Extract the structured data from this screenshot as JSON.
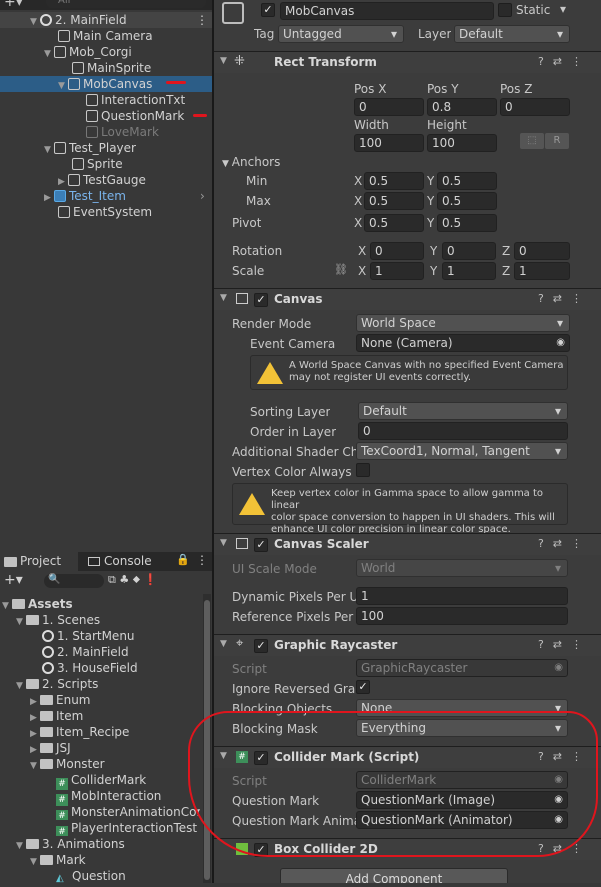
{
  "hierarchy": {
    "search_placeholder": "All",
    "items": [
      {
        "label": "2. MainField"
      },
      {
        "label": "Main Camera"
      },
      {
        "label": "Mob_Corgi"
      },
      {
        "label": "MainSprite"
      },
      {
        "label": "MobCanvas"
      },
      {
        "label": "InteractionTxt"
      },
      {
        "label": "QuestionMark"
      },
      {
        "label": "LoveMark"
      },
      {
        "label": "Test_Player"
      },
      {
        "label": "Sprite"
      },
      {
        "label": "TestGauge"
      },
      {
        "label": "Test_Item"
      },
      {
        "label": "EventSystem"
      }
    ]
  },
  "project": {
    "tab_project": "Project",
    "tab_console": "Console",
    "items": [
      {
        "label": "Assets"
      },
      {
        "label": "1. Scenes"
      },
      {
        "label": "1. StartMenu"
      },
      {
        "label": "2. MainField"
      },
      {
        "label": "3. HouseField"
      },
      {
        "label": "2. Scripts"
      },
      {
        "label": "Enum"
      },
      {
        "label": "Item"
      },
      {
        "label": "Item_Recipe"
      },
      {
        "label": "JSJ"
      },
      {
        "label": "Monster"
      },
      {
        "label": "ColliderMark"
      },
      {
        "label": "MobInteraction"
      },
      {
        "label": "MonsterAnimationCon"
      },
      {
        "label": "PlayerInteractionTest"
      },
      {
        "label": "3. Animations"
      },
      {
        "label": "Mark"
      },
      {
        "label": "Question"
      }
    ]
  },
  "inspector": {
    "object_name": "MobCanvas",
    "static_label": "Static",
    "tag_label": "Tag",
    "tag_value": "Untagged",
    "layer_label": "Layer",
    "layer_value": "Default",
    "rect": {
      "title": "Rect Transform",
      "posx_label": "Pos X",
      "posy_label": "Pos Y",
      "posz_label": "Pos Z",
      "posx": "0",
      "posy": "0.8",
      "posz": "0",
      "width_label": "Width",
      "height_label": "Height",
      "width": "100",
      "height": "100",
      "r_button": "R",
      "anchors_label": "Anchors",
      "min_label": "Min",
      "max_label": "Max",
      "pivot_label": "Pivot",
      "min_x": "0.5",
      "min_y": "0.5",
      "max_x": "0.5",
      "max_y": "0.5",
      "pivot_x": "0.5",
      "pivot_y": "0.5",
      "rotation_label": "Rotation",
      "scale_label": "Scale",
      "rot_x": "0",
      "rot_y": "0",
      "rot_z": "0",
      "scale_x": "1",
      "scale_y": "1",
      "scale_z": "1",
      "x": "X",
      "y": "Y",
      "z": "Z"
    },
    "canvas": {
      "title": "Canvas",
      "render_mode_label": "Render Mode",
      "render_mode": "World Space",
      "event_camera_label": "Event Camera",
      "event_camera": "None (Camera)",
      "warn1_line1": "A World Space Canvas with no specified Event Camera",
      "warn1_line2": "may not register UI events correctly.",
      "sorting_layer_label": "Sorting Layer",
      "sorting_layer": "Default",
      "order_label": "Order in Layer",
      "order": "0",
      "shader_label": "Additional Shader Cha",
      "shader": "TexCoord1, Normal, Tangent",
      "vertex_label": "Vertex Color Always In",
      "warn2_line1": "Keep vertex color in Gamma space to allow gamma to linear",
      "warn2_line2": "color space conversion to happen in UI shaders. This will",
      "warn2_line3": "enhance UI color precision in linear color space."
    },
    "scaler": {
      "title": "Canvas Scaler",
      "ui_scale_label": "UI Scale Mode",
      "ui_scale": "World",
      "dyn_label": "Dynamic Pixels Per U",
      "dyn": "1",
      "ref_label": "Reference Pixels Per U",
      "ref": "100"
    },
    "raycaster": {
      "title": "Graphic Raycaster",
      "script_label": "Script",
      "script": "GraphicRaycaster",
      "ignore_label": "Ignore Reversed Grap",
      "blocking_objects_label": "Blocking Objects",
      "blocking_objects": "None",
      "blocking_mask_label": "Blocking Mask",
      "blocking_mask": "Everything"
    },
    "collider_mark": {
      "title": "Collider Mark (Script)",
      "script_label": "Script",
      "script": "ColliderMark",
      "qm_label": "Question Mark",
      "qm": "QuestionMark (Image)",
      "qma_label": "Question Mark Anima",
      "qma": "QuestionMark (Animator)"
    },
    "box_collider_title": "Box Collider 2D",
    "add_component": "Add Component"
  },
  "colors": {
    "selection": "#2c5d87",
    "annotation": "#e0151d",
    "warning": "#f2c237"
  }
}
